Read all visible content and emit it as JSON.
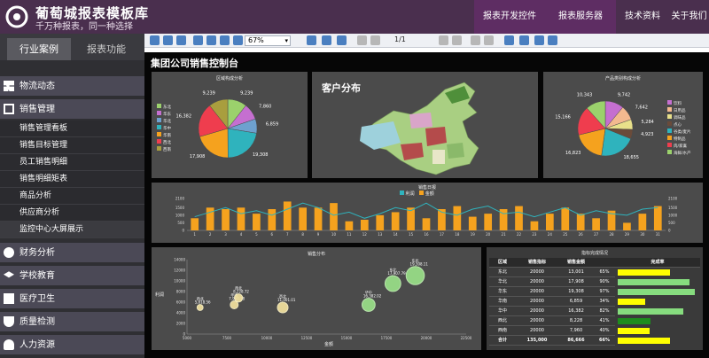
{
  "header": {
    "brand": "葡萄城报表模板库",
    "slogan": "千万种报表，同一种选择",
    "nav": [
      "报表开发控件",
      "报表服务器",
      "技术资料",
      "关于我们"
    ]
  },
  "sidebar": {
    "tabs": [
      "行业案例",
      "报表功能"
    ],
    "sections": [
      {
        "label": "物流动态"
      },
      {
        "label": "销售管理",
        "items": [
          "销售管理看板",
          "销售目标管理",
          "员工销售明细",
          "销售明细矩表",
          "商品分析",
          "供应商分析",
          "监控中心大屏展示"
        ]
      },
      {
        "label": "财务分析"
      },
      {
        "label": "学校教育"
      },
      {
        "label": "医疗卫生"
      },
      {
        "label": "质量检测"
      },
      {
        "label": "人力资源"
      }
    ]
  },
  "toolbar": {
    "zoom": "67%",
    "page": "1/1"
  },
  "dashboard": {
    "title": "集团公司销售控制台",
    "pie1": {
      "title": "区域构成分析",
      "legend": [
        "东北",
        "华东",
        "华北",
        "华中",
        "华南",
        "西北",
        "西南"
      ],
      "labels": [
        "9,239",
        "7,860",
        "6,859",
        "19,308",
        "17,908",
        "16,382",
        "9,239"
      ]
    },
    "map": {
      "title": "客户分布"
    },
    "pie2": {
      "title": "产品类别构成分析",
      "legend": [
        "饮料",
        "日用品",
        "调味品",
        "点心",
        "谷类/麦片",
        "特制品",
        "肉/家禽",
        "海鲜/水产"
      ],
      "labels": [
        "9,742",
        "7,642",
        "5,284",
        "4,923",
        "18,655",
        "16,823",
        "15,166",
        "10,343"
      ]
    },
    "bar": {
      "title": "销售日报",
      "legend": [
        "利润",
        "金额"
      ]
    },
    "bubble": {
      "title": "销售分布",
      "xlabel": "金额",
      "ylabel": "利润",
      "points": [
        {
          "label": "西北",
          "value": "5,818.56"
        },
        {
          "label": "华南",
          "value": "7,960.18"
        },
        {
          "label": "西北",
          "value": "8,228.72"
        },
        {
          "label": "西北",
          "value": "11,001.01"
        },
        {
          "label": "华中",
          "value": "16,382.02"
        },
        {
          "label": "东北",
          "value": "17,907.79"
        },
        {
          "label": "东北",
          "value": "19,308.11"
        }
      ]
    },
    "table": {
      "title": "指标完成情况",
      "headers": [
        "区域",
        "销售指标",
        "销售金额",
        "",
        "完成率"
      ],
      "rows": [
        [
          "东北",
          "20000",
          "13,001",
          "65%"
        ],
        [
          "华北",
          "20000",
          "17,908",
          "90%"
        ],
        [
          "华东",
          "20000",
          "19,308",
          "97%"
        ],
        [
          "华南",
          "20000",
          "6,859",
          "34%"
        ],
        [
          "华中",
          "20000",
          "16,382",
          "82%"
        ],
        [
          "西北",
          "20000",
          "8,228",
          "41%"
        ],
        [
          "西南",
          "20000",
          "7,960",
          "40%"
        ]
      ],
      "total": [
        "合计",
        "135,000",
        "86,666",
        "66%"
      ]
    }
  },
  "chart_data": [
    {
      "type": "pie",
      "title": "区域构成分析",
      "categories": [
        "东北",
        "华东",
        "华北",
        "华中",
        "华南",
        "西北",
        "西南"
      ],
      "values": [
        9239,
        7860,
        6859,
        19308,
        17908,
        16382,
        9239
      ],
      "colors": [
        "#9bd16c",
        "#c56fd0",
        "#6ea1cf",
        "#2fb3bd",
        "#f5a21e",
        "#ef3d4e",
        "#a99e3e"
      ]
    },
    {
      "type": "pie",
      "title": "产品类别构成分析",
      "categories": [
        "饮料",
        "日用品",
        "调味品",
        "点心",
        "谷类/麦片",
        "特制品",
        "肉/家禽",
        "海鲜/水产"
      ],
      "values": [
        9742,
        7642,
        5284,
        4923,
        18655,
        16823,
        15166,
        10343
      ],
      "colors": [
        "#c56fd0",
        "#f3b98f",
        "#e8e08a",
        "#6a4b3a",
        "#2fb3bd",
        "#f5a21e",
        "#ef3d4e",
        "#9bd16c"
      ]
    },
    {
      "type": "bar",
      "title": "销售日报",
      "x": [
        1,
        2,
        3,
        4,
        5,
        6,
        7,
        8,
        9,
        10,
        11,
        12,
        13,
        14,
        15,
        16,
        17,
        18,
        19,
        20,
        21,
        22,
        23,
        24,
        25,
        26,
        27,
        28,
        29,
        30,
        31
      ],
      "series": [
        {
          "name": "金额",
          "values": [
            800,
            1500,
            1400,
            1500,
            1100,
            1400,
            1900,
            1500,
            1500,
            1800,
            600,
            700,
            1000,
            1200,
            1500,
            800,
            1400,
            1600,
            900,
            1100,
            1400,
            1600,
            600,
            1100,
            1500,
            1100,
            800,
            1300,
            500,
            1100,
            1600
          ]
        },
        {
          "name": "利润",
          "values": [
            900,
            1200,
            1500,
            1100,
            1300,
            1000,
            1400,
            1800,
            1500,
            1000,
            1200,
            800,
            1100,
            1500,
            1300,
            1800,
            1200,
            1000,
            1400,
            1600,
            1100,
            1200,
            900,
            1200,
            1500,
            1000,
            1300,
            1100,
            1000,
            1400,
            1500
          ]
        }
      ],
      "ylim": [
        0,
        2100
      ]
    },
    {
      "type": "scatter",
      "title": "销售分布",
      "xlabel": "金额",
      "ylabel": "利润",
      "points": [
        {
          "label": "西北",
          "x": 5819,
          "y": 5000
        },
        {
          "label": "华南",
          "x": 7960,
          "y": 5500
        },
        {
          "label": "西北",
          "x": 8229,
          "y": 6800
        },
        {
          "label": "西北",
          "x": 11001,
          "y": 5000
        },
        {
          "label": "华中",
          "x": 16382,
          "y": 5500
        },
        {
          "label": "东北",
          "x": 17908,
          "y": 9500
        },
        {
          "label": "东北",
          "x": 19308,
          "y": 11000
        }
      ],
      "xlim": [
        5000,
        22500
      ],
      "ylim": [
        0,
        14000
      ]
    }
  ]
}
